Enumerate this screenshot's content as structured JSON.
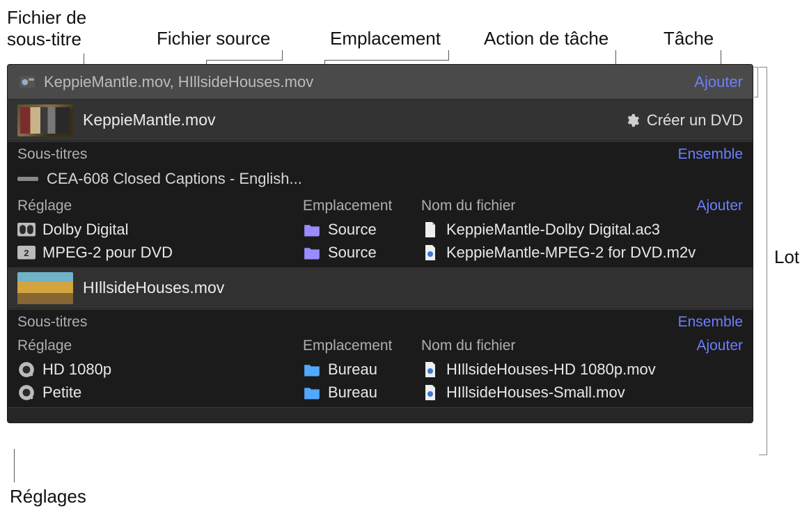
{
  "callouts": {
    "subtitle_file": "Fichier de\nsous-titre",
    "source_file": "Fichier source",
    "location": "Emplacement",
    "task_action": "Action de tâche",
    "task": "Tâche",
    "batch": "Lot",
    "settings": "Réglages"
  },
  "batch": {
    "header_files": "KeppieMantle.mov, HIllsideHouses.mov",
    "add_label": "Ajouter"
  },
  "tasks": [
    {
      "name": "KeppieMantle.mov",
      "action": "Créer un DVD",
      "captions_header": "Sous-titres",
      "captions_set_label": "Ensemble",
      "caption_item": "CEA-608 Closed Captions - English...",
      "columns": {
        "setting": "Réglage",
        "location": "Emplacement",
        "filename": "Nom du fichier",
        "add": "Ajouter"
      },
      "outputs": [
        {
          "setting_icon": "dolby",
          "setting": "Dolby Digital",
          "folder_style": "purple",
          "location": "Source",
          "file_icon": "doc",
          "filename": "KeppieMantle-Dolby Digital.ac3"
        },
        {
          "setting_icon": "mpeg2",
          "setting": "MPEG-2 pour DVD",
          "folder_style": "purple",
          "location": "Source",
          "file_icon": "mpeg",
          "filename": "KeppieMantle-MPEG-2 for DVD.m2v"
        }
      ]
    },
    {
      "name": "HIllsideHouses.mov",
      "action": "",
      "captions_header": "Sous-titres",
      "captions_set_label": "Ensemble",
      "caption_item": "",
      "columns": {
        "setting": "Réglage",
        "location": "Emplacement",
        "filename": "Nom du fichier",
        "add": "Ajouter"
      },
      "outputs": [
        {
          "setting_icon": "qt",
          "setting": "HD 1080p",
          "folder_style": "blue",
          "location": "Bureau",
          "file_icon": "mov",
          "filename": "HIllsideHouses-HD 1080p.mov"
        },
        {
          "setting_icon": "qt",
          "setting": "Petite",
          "folder_style": "blue",
          "location": "Bureau",
          "file_icon": "mov",
          "filename": "HIllsideHouses-Small.mov"
        }
      ]
    }
  ]
}
